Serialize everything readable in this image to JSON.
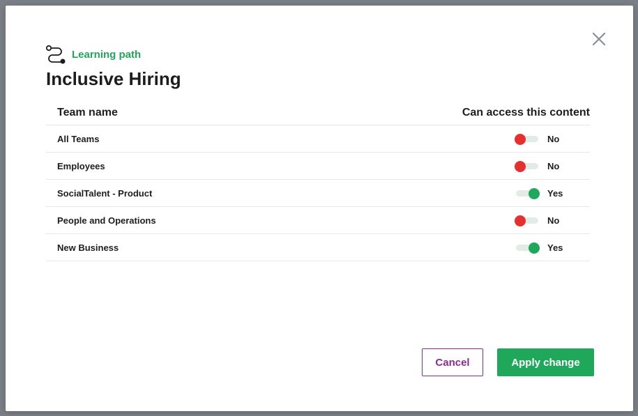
{
  "modal": {
    "eyebrow": "Learning path",
    "title": "Inclusive Hiring",
    "close_icon": "close-icon",
    "eyebrow_icon": "learning-path-icon"
  },
  "table": {
    "headers": {
      "team": "Team name",
      "access": "Can access this content"
    },
    "rows": [
      {
        "name": "All Teams",
        "access": false,
        "label": "No"
      },
      {
        "name": "Employees",
        "access": false,
        "label": "No"
      },
      {
        "name": "SocialTalent - Product",
        "access": true,
        "label": "Yes"
      },
      {
        "name": "People and Operations",
        "access": false,
        "label": "No"
      },
      {
        "name": "New Business",
        "access": true,
        "label": "Yes"
      }
    ]
  },
  "actions": {
    "cancel": "Cancel",
    "apply": "Apply change"
  },
  "colors": {
    "brand_green": "#1fa85a",
    "danger_red": "#e63030",
    "cancel_purple": "#8b2d8f"
  }
}
